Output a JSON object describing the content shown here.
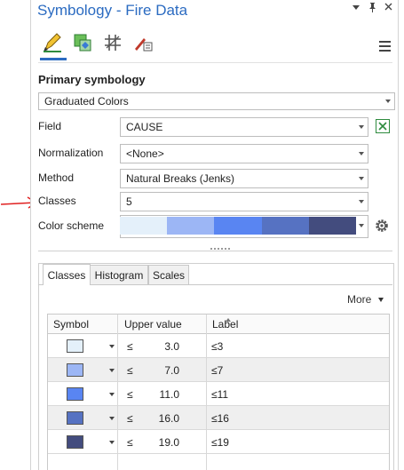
{
  "pane": {
    "title": "Symbology - Fire Data",
    "controls": [
      "chevron-down-icon",
      "pin-icon",
      "close-icon"
    ]
  },
  "toolbar": {
    "tools": [
      "primary-symbology-icon",
      "vary-symbology-icon",
      "symbol-layer-drawing-icon",
      "advanced-symbology-icon"
    ],
    "menu_icon": "menu-icon"
  },
  "primary": {
    "section_title": "Primary symbology",
    "method_type": "Graduated Colors"
  },
  "form": {
    "field_label": "Field",
    "field_value": "CAUSE",
    "normalization_label": "Normalization",
    "normalization_value": "<None>",
    "method_label": "Method",
    "method_value": "Natural Breaks (Jenks)",
    "classes_label": "Classes",
    "classes_value": "5",
    "color_scheme_label": "Color scheme",
    "color_scheme_colors": [
      "#e4f0fa",
      "#9cb6f5",
      "#5985f2",
      "#5672c2",
      "#434c7e"
    ]
  },
  "tabs": [
    "Classes",
    "Histogram",
    "Scales"
  ],
  "more_label": "More",
  "grid": {
    "headers": {
      "symbol": "Symbol",
      "upper": "Upper value",
      "label": "Label"
    },
    "rows": [
      {
        "color": "#e4f0fa",
        "le": "≤",
        "upper": "3.0",
        "label": "≤3"
      },
      {
        "color": "#9cb6f5",
        "le": "≤",
        "upper": "7.0",
        "label": "≤7"
      },
      {
        "color": "#5985f2",
        "le": "≤",
        "upper": "11.0",
        "label": "≤11"
      },
      {
        "color": "#5672c2",
        "le": "≤",
        "upper": "16.0",
        "label": "≤16"
      },
      {
        "color": "#434c7e",
        "le": "≤",
        "upper": "19.0",
        "label": "≤19"
      }
    ]
  },
  "colors": {
    "accent": "#2b6bc1",
    "annotation_arrow": "#e02020"
  }
}
